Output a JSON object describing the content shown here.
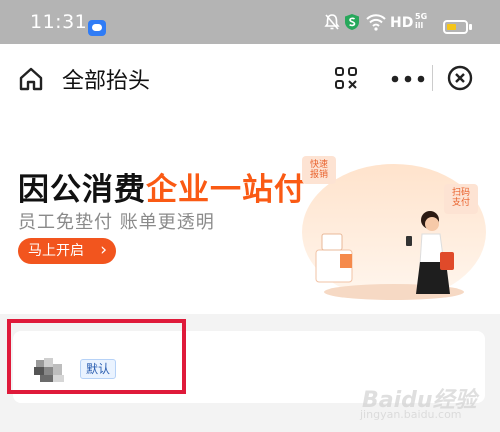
{
  "status_bar": {
    "time": "11:31",
    "network": "HD",
    "signal_label": "5G\nill",
    "battery_level": 0.55,
    "icons": [
      "app-chip-icon",
      "mute-bell-icon",
      "shield-icon",
      "wifi-icon",
      "battery-icon"
    ]
  },
  "nav": {
    "title": "全部抬头",
    "icons": [
      "home-icon",
      "scan-icon",
      "more-icon",
      "close-icon"
    ]
  },
  "banner": {
    "title_part1": "因公消费",
    "title_part2": "企业一站付",
    "subtitle": "员工免垫付 账单更透明",
    "cta_label": "马上开启",
    "tag_left": "快速\n报销",
    "tag_right": "扫码\n支付",
    "accent_color": "#fa5a14"
  },
  "card": {
    "default_badge": "默认"
  },
  "watermark": {
    "main": "Baidu经验",
    "sub": "jingyan.baidu.com"
  },
  "colors": {
    "status_bar_bg": "#b4b4b4",
    "highlight_border": "#df1a3a",
    "page_bg": "#f3f3f3"
  }
}
